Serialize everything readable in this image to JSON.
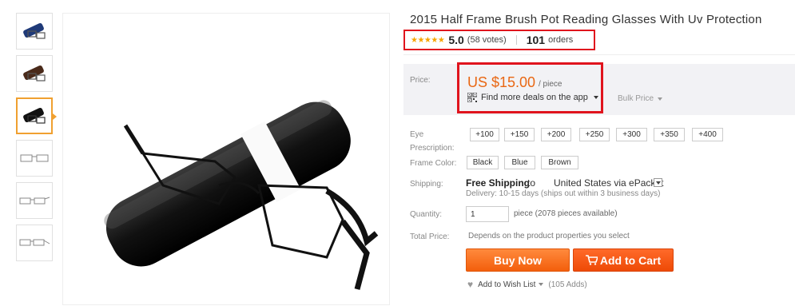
{
  "product": {
    "title": "2015 Half Frame Brush Pot Reading Glasses With Uv Protection"
  },
  "rating": {
    "stars": "★★★★★",
    "score": "5.0",
    "votes": "(58 votes)",
    "orders_count": "101",
    "orders_label": "orders"
  },
  "price": {
    "label": "Price:",
    "amount": "US $15.00",
    "unit": "/ piece",
    "deals_text": "Find more deals on the app",
    "bulk_label": "Bulk Price"
  },
  "eye_prescription": {
    "label_line1": "Eye",
    "label_line2": "Prescription:",
    "options": [
      "+100",
      "+150",
      "+200",
      "+250",
      "+300",
      "+350",
      "+400"
    ]
  },
  "frame_color": {
    "label": "Frame Color:",
    "options": [
      "Black",
      "Blue",
      "Brown"
    ]
  },
  "shipping": {
    "label": "Shipping:",
    "free_text": "Free Shipping",
    "to_text": "to",
    "destination": "United States via ePacket",
    "delivery": "Delivery: 10-15 days (ships out within 3 business days)"
  },
  "quantity": {
    "label": "Quantity:",
    "value": "1",
    "unit_text": "piece (2078 pieces available)"
  },
  "total": {
    "label": "Total Price:",
    "value": "Depends on the product properties you select"
  },
  "actions": {
    "buy_now": "Buy Now",
    "add_to_cart": "Add to Cart",
    "cart_icon": "cart-icon",
    "wish_list": "Add to Wish List",
    "wish_count": "(105 Adds)"
  },
  "colors": {
    "price_orange": "#e96713",
    "highlight_red": "#e0141d",
    "star_gold": "#f7a400",
    "thumb_active": "#f0a030"
  }
}
